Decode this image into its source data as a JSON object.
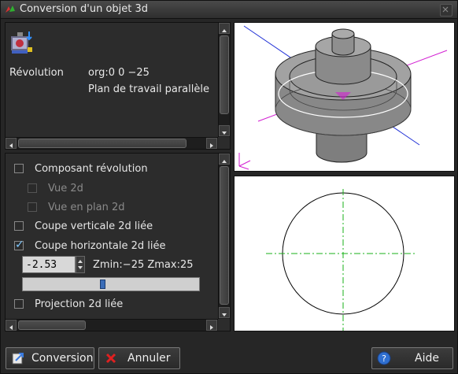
{
  "window": {
    "title": "Conversion d'un objet 3d",
    "title_icon": "app-icon",
    "close_icon": "close-icon"
  },
  "info": {
    "icon": "revolution-object-icon",
    "type_label": "Révolution",
    "origin_label": "org:0 0 −25",
    "plane_label": "Plan de travail parallèle"
  },
  "options": {
    "composant_revolution": "Composant révolution",
    "vue_2d": "Vue 2d",
    "vue_en_plan_2d": "Vue en plan 2d",
    "coupe_verticale": "Coupe verticale 2d liée",
    "coupe_horizontale": "Coupe horizontale 2d liée",
    "projection": "Projection 2d liée",
    "coupe_horizontale_checked": true
  },
  "cut": {
    "value": "-2.53",
    "range_label": "Zmin:−25 Zmax:25",
    "slider_position": 0.45
  },
  "buttons": {
    "conversion": "Conversion",
    "annuler": "Annuler",
    "aide": "Aide"
  },
  "colors": {
    "axis_blue": "#1f2fd6",
    "axis_magenta": "#d21fd2",
    "axis_green": "#19b019",
    "object_gray": "#8c8c8c"
  }
}
